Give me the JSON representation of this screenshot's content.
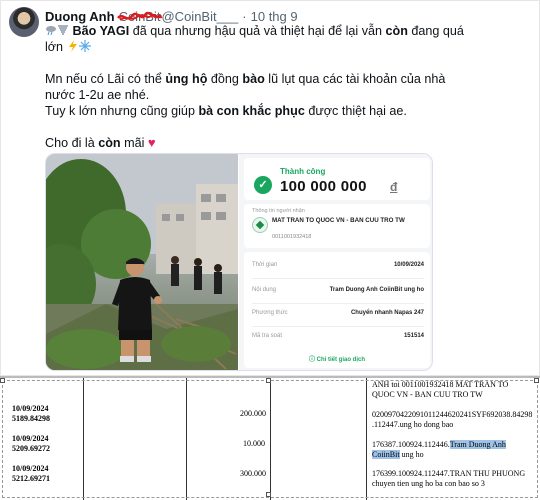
{
  "tweet": {
    "display_name": "Duong Anh",
    "handle_prefix": "CoinBit",
    "handle": "@CoinBit___",
    "separator": "·",
    "date": "10 thg 9",
    "lines": {
      "l1a": "Bão YAGI",
      "l1b": " đã qua nhưng hậu quả và thiệt hại để lại vẫn ",
      "l1c": "còn",
      "l1d": " đang quá",
      "l2": "lớn",
      "l3a": "Mn nếu có Lãi có thể ",
      "l3b": "ủng hộ",
      "l3c": " đồng ",
      "l3d": "bào",
      "l3e": " lũ lụt qua các tài khoản của nhà",
      "l4": "nước 1-2u ae nhé.",
      "l5a": "Tuy k lớn nhưng cũng giúp ",
      "l5b": "bà con khắc phục",
      "l5c": " được thiệt hại ae.",
      "l6a": "Cho đi là ",
      "l6b": "còn",
      "l6c": " mãi ",
      "heart": "♥"
    },
    "emoji": [
      "storm-cloud-emoji",
      "tornado-emoji",
      "lightning-emoji",
      "snowflake-emoji"
    ]
  },
  "receipt": {
    "status": "Thành công",
    "amount": "100 000 000",
    "currency": "đ",
    "recipient_title": "Thông tin người nhận",
    "recipient_name": "MAT TRAN TO QUOC VN - BAN CUU TRO TW",
    "recipient_account": "0011001932418",
    "rows": [
      {
        "k": "Thời gian",
        "v": "10/09/2024"
      },
      {
        "k": "Nội dung",
        "v": "Tram Duong Anh CoiinBit ung ho"
      },
      {
        "k": "Phương thức",
        "v": "Chuyển nhanh Napas 247"
      },
      {
        "k": "Mã tra soát",
        "v": "151514"
      }
    ],
    "details_link": "Chi tiết giao dịch",
    "colors": {
      "accent": "#19a760"
    }
  },
  "statement": {
    "header_text_1": "ANH toi 0011001932418 MAT TRAN TO",
    "header_text_2": "QUOC VN - BAN CUU TRO TW",
    "rows": [
      {
        "date": "10/09/2024",
        "ref": "5189.84298",
        "amount": "200.000",
        "desc1": "0200970422091011244620241SYF692038.84298",
        "desc2": ".112447.ung ho dong bao"
      },
      {
        "date": "10/09/2024",
        "ref": "5209.69272",
        "amount": "10.000",
        "desc1_pre": "176387.100924.112446.",
        "desc1_hl": "Tram Duong Anh",
        "desc2_hl": "CoiinBit",
        "desc2_post": " ung ho"
      },
      {
        "date": "10/09/2024",
        "ref": "5212.69271",
        "amount": "300.000",
        "desc1": "176399.100924.112447.TRAN THU PHUONG",
        "desc2": "chuyen tien ung ho ba con bao so 3"
      }
    ],
    "colors": {
      "highlight": "#9fc3e7"
    }
  }
}
